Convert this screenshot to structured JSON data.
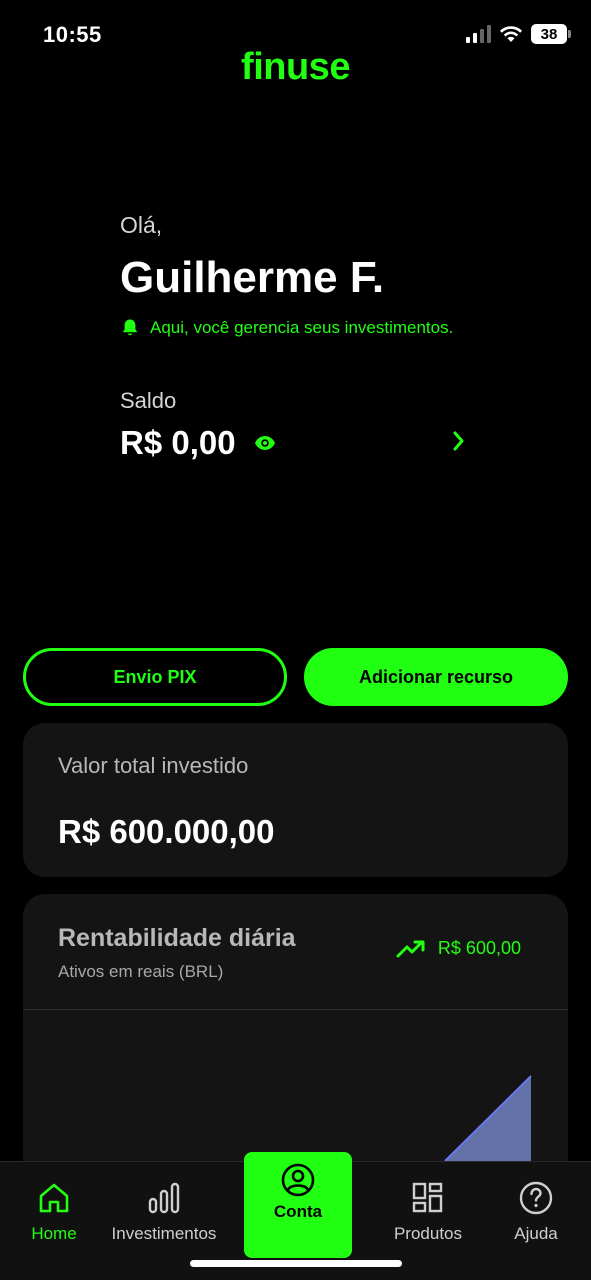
{
  "status_bar": {
    "time": "10:55",
    "battery": "38"
  },
  "brand": {
    "logo_text": "finuse",
    "color": "#21ff12"
  },
  "greeting": {
    "hello": "Olá,",
    "user_name": "Guilherme F.",
    "notice": "Aqui, você gerencia seus investimentos.",
    "notice_icon": "bell-icon"
  },
  "balance": {
    "label": "Saldo",
    "value": "R$ 0,00",
    "visibility_icon": "eye-icon"
  },
  "actions": {
    "pix_label": "Envio PIX",
    "add_label": "Adicionar recurso"
  },
  "invested": {
    "label": "Valor total investido",
    "value": "R$ 600.000,00"
  },
  "rentability": {
    "title": "Rentabilidade diária",
    "subtitle": "Ativos em reais (BRL)",
    "gain": "R$ 600,00",
    "gain_icon": "trending-up-icon"
  },
  "chart_data": {
    "type": "area",
    "title": "Rentabilidade diária",
    "series": [
      {
        "values": [
          0,
          0,
          0,
          0,
          600
        ]
      }
    ],
    "colors": {
      "line": "#6a78f0",
      "fill": "#6a7bb8"
    }
  },
  "nav": {
    "items": [
      {
        "label": "Home",
        "icon": "home-icon",
        "active": true
      },
      {
        "label": "Investimentos",
        "icon": "bar-chart-icon"
      },
      {
        "label": "Conta",
        "icon": "user-circle-icon"
      },
      {
        "label": "Produtos",
        "icon": "grid-icon"
      },
      {
        "label": "Ajuda",
        "icon": "help-icon"
      }
    ]
  }
}
